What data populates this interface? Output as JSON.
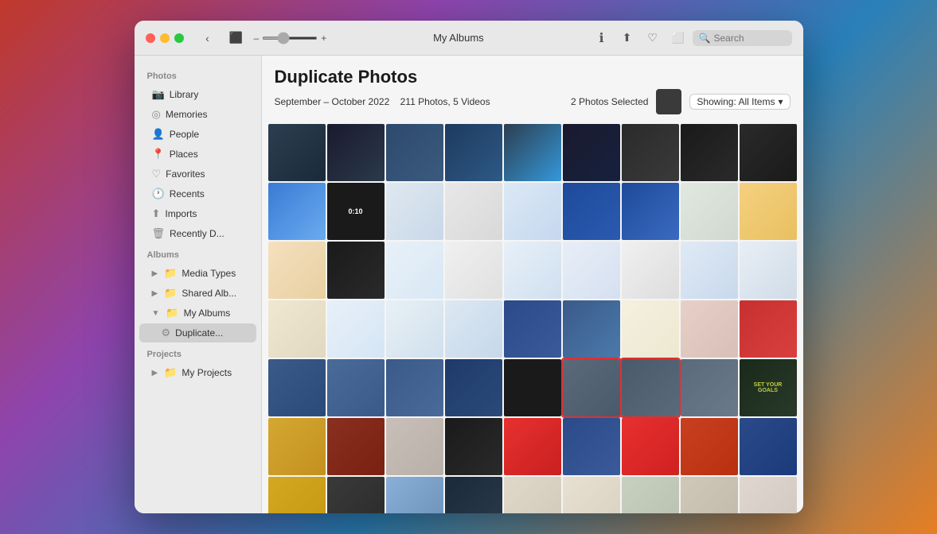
{
  "window": {
    "title": "My Albums"
  },
  "toolbar": {
    "back_label": "‹",
    "slideshow_label": "⬛",
    "zoom_minus": "–",
    "zoom_plus": "+",
    "info_label": "ⓘ",
    "share_label": "↑",
    "favorite_label": "♡",
    "crop_label": "⬜",
    "search_placeholder": "Search"
  },
  "sidebar": {
    "photos_section": "Photos",
    "items_photos": [
      {
        "id": "library",
        "label": "Library",
        "icon": "📷"
      },
      {
        "id": "memories",
        "label": "Memories",
        "icon": "◎"
      },
      {
        "id": "people",
        "label": "People",
        "icon": "👤"
      },
      {
        "id": "places",
        "label": "Places",
        "icon": "📍"
      },
      {
        "id": "favorites",
        "label": "Favorites",
        "icon": "♡"
      },
      {
        "id": "recents",
        "label": "Recents",
        "icon": "🕐"
      },
      {
        "id": "imports",
        "label": "Imports",
        "icon": "⬆"
      },
      {
        "id": "recently-deleted",
        "label": "Recently D...",
        "icon": "🗑"
      }
    ],
    "albums_section": "Albums",
    "items_albums": [
      {
        "id": "media-types",
        "label": "Media Types",
        "icon": "📁",
        "expand": true
      },
      {
        "id": "shared-albums",
        "label": "Shared Alb...",
        "icon": "📁",
        "expand": true
      },
      {
        "id": "my-albums",
        "label": "My Albums",
        "icon": "📁",
        "expand": true,
        "active_child": true
      }
    ],
    "my_albums_child": {
      "id": "duplicate-photos",
      "label": "Duplicate...",
      "active": true
    },
    "projects_section": "Projects",
    "items_projects": [
      {
        "id": "my-projects",
        "label": "My Projects",
        "icon": "📁",
        "expand": true
      }
    ]
  },
  "content": {
    "title": "Duplicate Photos",
    "date_range": "September – October 2022",
    "count": "211 Photos, 5 Videos",
    "selected_count": "2 Photos Selected",
    "showing_label": "Showing: All Items",
    "grid_rows": 7,
    "selected_cells": [
      {
        "row": 5,
        "col": 7
      },
      {
        "row": 5,
        "col": 8
      }
    ]
  },
  "colors": {
    "accent_red": "#e03030",
    "sidebar_bg": "#ebebeb",
    "active_item": "#d0d0d0"
  }
}
